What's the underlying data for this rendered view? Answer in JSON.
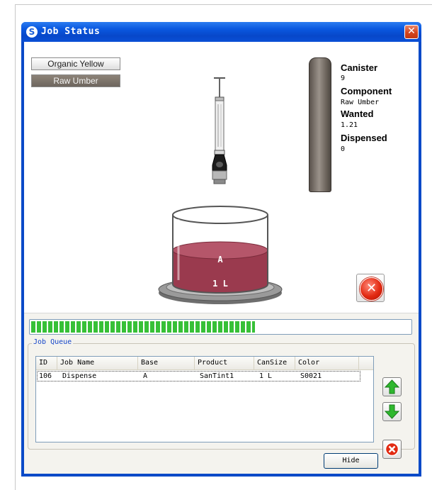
{
  "window": {
    "title": "Job Status",
    "app_icon": "S"
  },
  "components": [
    "Organic Yellow",
    "Raw Umber"
  ],
  "info": {
    "canister_label": "Canister",
    "canister_value": "9",
    "component_label": "Component",
    "component_value": "Raw Umber",
    "wanted_label": "Wanted",
    "wanted_value": "1.21",
    "dispensed_label": "Dispensed",
    "dispensed_value": "0"
  },
  "can": {
    "base_label": "A",
    "size_label": "1 L",
    "paint_color": "#9a3a4e"
  },
  "progress": {
    "fraction": 0.59,
    "color": "#37c037"
  },
  "job_queue": {
    "title": "Job Queue",
    "columns": [
      "ID",
      "Job Name",
      "Base",
      "Product",
      "CanSize",
      "Color"
    ],
    "rows": [
      {
        "id": "106",
        "job_name": "Dispense",
        "base": "A",
        "product": "SanTint1",
        "cansize": "1 L",
        "color": "S0021"
      }
    ]
  },
  "buttons": {
    "hide_label": "Hide"
  },
  "colors": {
    "titlebar": "#0a58e0",
    "accent": "#1646c8"
  }
}
